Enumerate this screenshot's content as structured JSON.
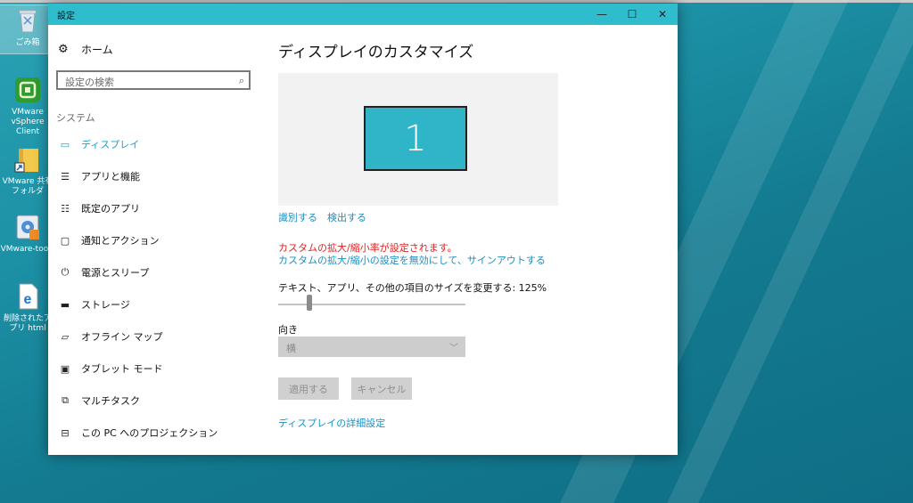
{
  "desktop": {
    "icons": [
      {
        "label": "ごみ箱",
        "icon": "recycle-bin-icon"
      },
      {
        "label": "VMware vSphere Client",
        "icon": "vmware-vsphere-icon"
      },
      {
        "label": "VMware 共有フォルダ",
        "icon": "shared-folder-shortcut-icon"
      },
      {
        "label": "VMware-tools",
        "icon": "installer-icon"
      },
      {
        "label": "削除されたアプリ html",
        "icon": "edge-html-icon"
      }
    ]
  },
  "window": {
    "title": "設定",
    "controls": {
      "minimize": "—",
      "maximize": "☐",
      "close": "✕"
    }
  },
  "sidebar": {
    "home": {
      "label": "ホーム",
      "icon": "gear-icon"
    },
    "search_placeholder": "設定の検索",
    "section": "システム",
    "items": [
      {
        "label": "ディスプレイ",
        "icon": "monitor-icon",
        "active": true
      },
      {
        "label": "アプリと機能",
        "icon": "apps-list-icon"
      },
      {
        "label": "既定のアプリ",
        "icon": "default-apps-icon"
      },
      {
        "label": "通知とアクション",
        "icon": "notification-icon"
      },
      {
        "label": "電源とスリープ",
        "icon": "power-icon"
      },
      {
        "label": "ストレージ",
        "icon": "storage-icon"
      },
      {
        "label": "オフライン マップ",
        "icon": "map-icon"
      },
      {
        "label": "タブレット モード",
        "icon": "tablet-icon"
      },
      {
        "label": "マルチタスク",
        "icon": "multitask-icon"
      },
      {
        "label": "この PC へのプロジェクション",
        "icon": "projection-icon"
      }
    ]
  },
  "main": {
    "title": "ディスプレイのカスタマイズ",
    "monitor_number": "1",
    "identify_link": "識別する",
    "detect_link": "検出する",
    "warning": "カスタムの拡大/縮小率が設定されます。",
    "disable_link": "カスタムの拡大/縮小の設定を無効にして、サインアウトする",
    "scale_label": "テキスト、アプリ、その他の項目のサイズを変更する: 125%",
    "scale_percent": 125,
    "slider_fraction": 0.15,
    "orientation_label": "向き",
    "orientation_value": "横",
    "apply_button": "適用する",
    "cancel_button": "キャンセル",
    "advanced_link": "ディスプレイの詳細設定"
  },
  "colors": {
    "accent": "#1aa2c9",
    "titlebar": "#2fbccd",
    "warning": "#e32222"
  }
}
